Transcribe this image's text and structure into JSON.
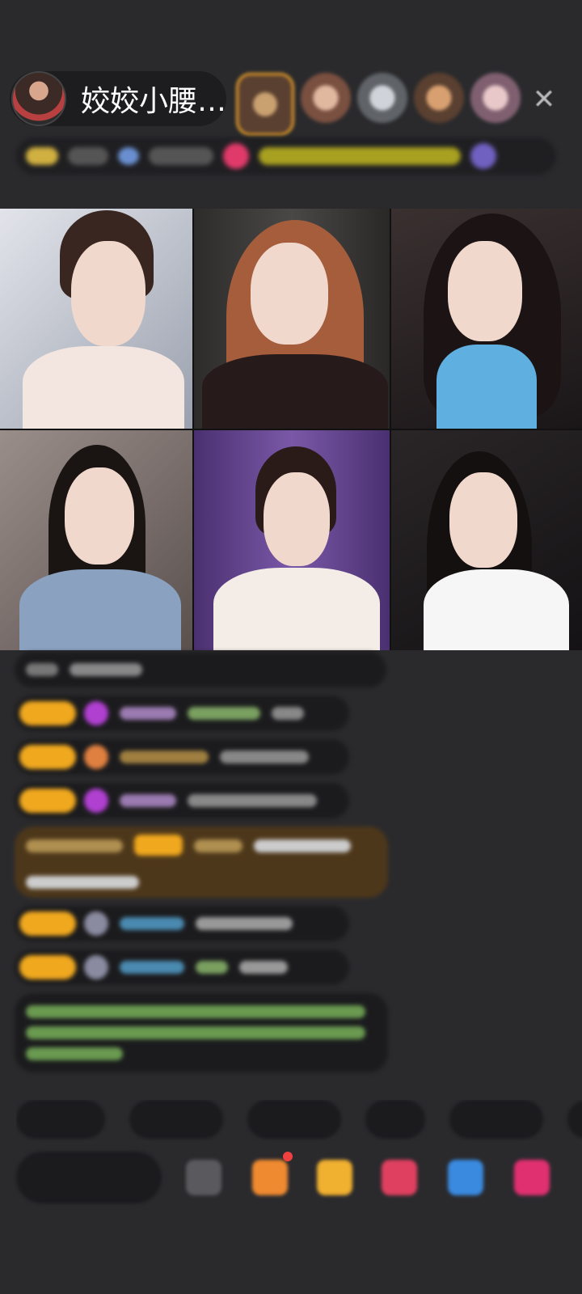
{
  "header": {
    "host_name": "姣姣小腰…",
    "close_icon": "close-icon"
  },
  "viewers": [
    {
      "name": "viewer-1",
      "color": "#7a5a40"
    },
    {
      "name": "viewer-2",
      "color": "#8a6a5a"
    },
    {
      "name": "viewer-3",
      "color": "#9aa0a8"
    },
    {
      "name": "viewer-4",
      "color": "#8a6048"
    },
    {
      "name": "viewer-5",
      "color": "#a890a0"
    }
  ],
  "video_tiles": [
    {
      "name": "streamer-1",
      "bg": "#c9cdd6",
      "hair": "#3a2620",
      "top": "#f3e5df"
    },
    {
      "name": "streamer-2",
      "bg": "#3a3836",
      "hair": "#a55d3c",
      "top": "#2a2020"
    },
    {
      "name": "streamer-3",
      "bg": "#2a2426",
      "hair": "#1c1414",
      "top": "#5fb0e0"
    },
    {
      "name": "streamer-4",
      "bg": "#7a6e6a",
      "hair": "#1a1412",
      "top": "#8aa2c0"
    },
    {
      "name": "streamer-5",
      "bg": "#5a3f7a",
      "hair": "#2a1a18",
      "top": "#f4ece6"
    },
    {
      "name": "streamer-6",
      "bg": "#1e1c1e",
      "hair": "#141010",
      "top": "#f6f6f6"
    }
  ],
  "colors": {
    "accent": "#f0a81e",
    "panel": "#1d1d20",
    "background": "#2a2a2d"
  }
}
